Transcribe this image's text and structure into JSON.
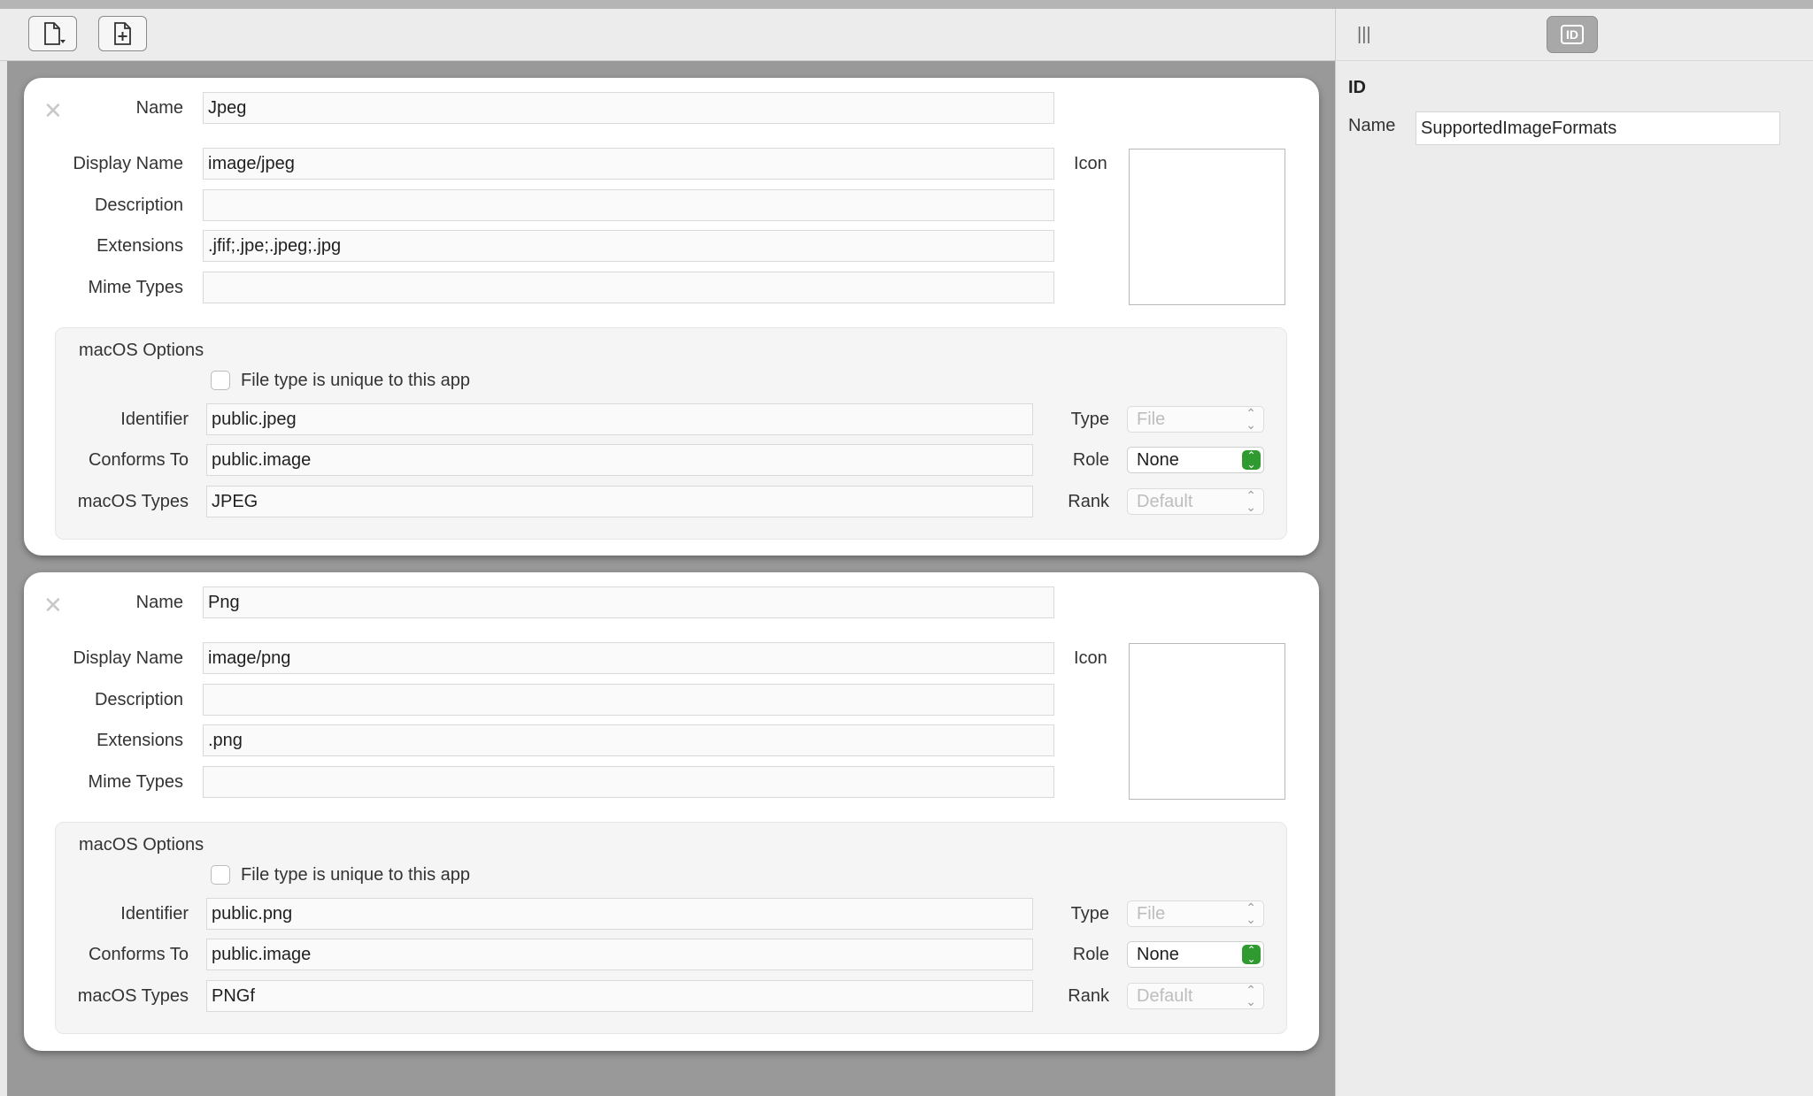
{
  "inspector": {
    "heading": "ID",
    "name_label": "Name",
    "name_value": "SupportedImageFormats",
    "columns_icon": "columns-icon",
    "id_button_label": "ID"
  },
  "toolbar": {
    "new_document_icon": "new-document-menu-icon",
    "add_document_icon": "add-document-icon"
  },
  "labels": {
    "name": "Name",
    "display_name": "Display Name",
    "description": "Description",
    "extensions": "Extensions",
    "mime_types": "Mime Types",
    "icon": "Icon",
    "macos_options": "macOS Options",
    "unique": "File type is unique to this app",
    "identifier": "Identifier",
    "conforms_to": "Conforms To",
    "macos_types": "macOS Types",
    "type": "Type",
    "role": "Role",
    "rank": "Rank"
  },
  "close_glyph": "✕",
  "documents": [
    {
      "name": "Jpeg",
      "display_name": "image/jpeg",
      "description": "",
      "extensions": ".jfif;.jpe;.jpeg;.jpg",
      "mime_types": "",
      "unique_checked": false,
      "identifier": "public.jpeg",
      "conforms_to": "public.image",
      "macos_types": "JPEG",
      "type": "File",
      "role": "None",
      "rank": "Default"
    },
    {
      "name": "Png",
      "display_name": "image/png",
      "description": "",
      "extensions": ".png",
      "mime_types": "",
      "unique_checked": false,
      "identifier": "public.png",
      "conforms_to": "public.image",
      "macos_types": "PNGf",
      "type": "File",
      "role": "None",
      "rank": "Default"
    }
  ],
  "colors": {
    "role_stepper": "#2f9a2f"
  }
}
